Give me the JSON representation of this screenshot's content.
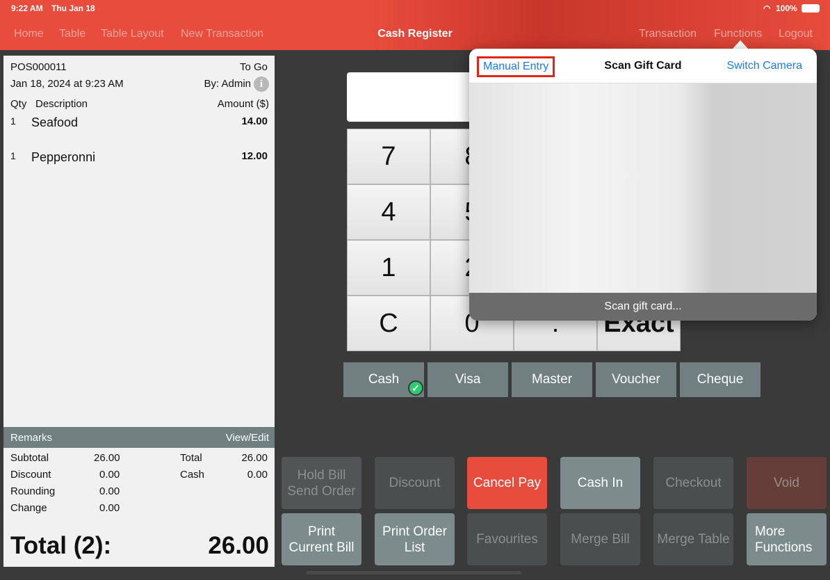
{
  "status": {
    "time": "9:22 AM",
    "date": "Thu Jan 18",
    "battery": "100%"
  },
  "nav": {
    "left": [
      "Home",
      "Table",
      "Table Layout",
      "New Transaction"
    ],
    "title": "Cash Register",
    "right": [
      "Transaction",
      "Functions",
      "Logout"
    ]
  },
  "receipt": {
    "id": "POS000011",
    "type": "To Go",
    "datetime": "Jan 18, 2024 at 9:23 AM",
    "by": "By: Admin",
    "headers": {
      "qty": "Qty",
      "desc": "Description",
      "amount": "Amount ($)"
    },
    "items": [
      {
        "qty": "1",
        "desc": "Seafood",
        "amount": "14.00"
      },
      {
        "qty": "1",
        "desc": "Pepperonni",
        "amount": "12.00"
      }
    ],
    "remarks": "Remarks",
    "view_edit": "View/Edit",
    "summary": {
      "subtotal_label": "Subtotal",
      "subtotal": "26.00",
      "discount_label": "Discount",
      "discount": "0.00",
      "rounding_label": "Rounding",
      "rounding": "0.00",
      "change_label": "Change",
      "change": "0.00",
      "total_label": "Total",
      "total": "26.00",
      "cash_label": "Cash",
      "cash": "0.00"
    },
    "grand_total_label": "Total (2):",
    "grand_total": "26.00"
  },
  "keypad": [
    "7",
    "8",
    "4",
    "5",
    "1",
    "2",
    "C",
    "0",
    ".",
    "Exact"
  ],
  "payments": [
    "Cash",
    "Visa",
    "Master",
    "Voucher",
    "Cheque"
  ],
  "selected_payment": "Cash",
  "functions": [
    [
      "Hold Bill\nSend Order",
      "Discount",
      "Cancel Pay",
      "Cash In",
      "Checkout",
      "Void"
    ],
    [
      "Print\nCurrent Bill",
      "Print Order\nList",
      "Favourites",
      "Merge Bill",
      "Merge Table",
      "More\nFunctions"
    ]
  ],
  "popover": {
    "manual_entry": "Manual Entry",
    "title": "Scan Gift Card",
    "switch_camera": "Switch Camera",
    "footer": "Scan gift card..."
  },
  "colors": {
    "brand": "#e74c3c",
    "link": "#1a7cf5",
    "highlight": "#e0261b"
  }
}
